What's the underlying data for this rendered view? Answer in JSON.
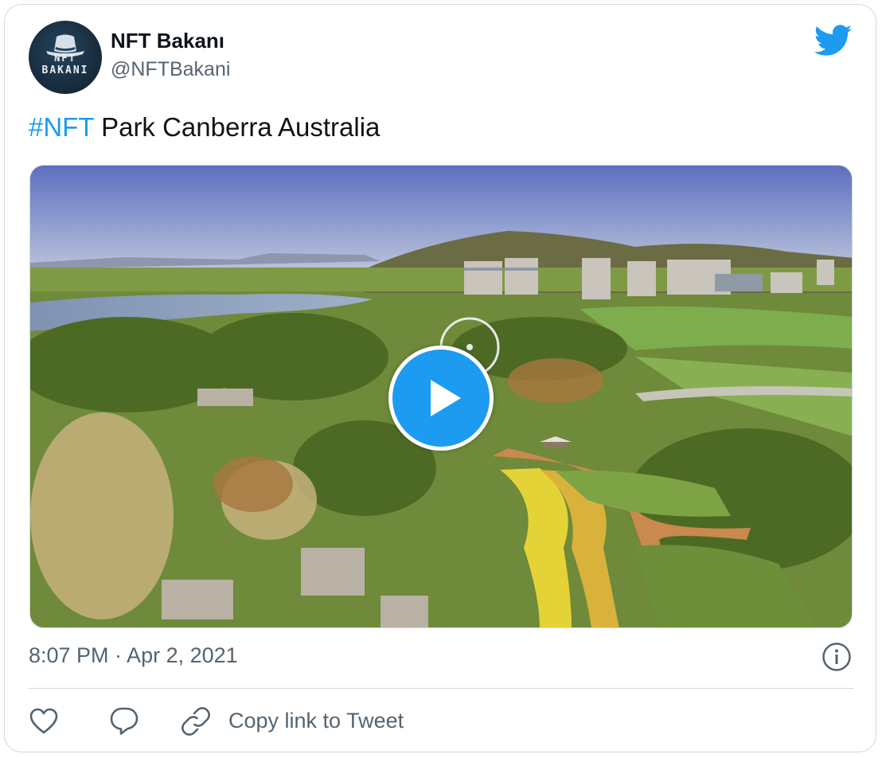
{
  "author": {
    "display_name": "NFT Bakanı",
    "handle": "@NFTBakani",
    "avatar_line1": "NFT",
    "avatar_line2": "BAKANI"
  },
  "tweet": {
    "hashtag": "#NFT",
    "text": " Park Canberra Australia"
  },
  "media": {
    "type": "video",
    "description_icon": "play-icon"
  },
  "footer": {
    "timestamp": "8:07 PM · Apr 2, 2021",
    "copy_link_label": "Copy link to Tweet"
  },
  "icons": {
    "brand": "twitter-bird-icon",
    "info": "info-icon",
    "like": "heart-icon",
    "reply": "speech-bubble-icon",
    "link": "link-icon"
  },
  "colors": {
    "accent": "#1d9bf0",
    "text": "#0f1419",
    "muted": "#536471",
    "border": "#cfd9de"
  }
}
